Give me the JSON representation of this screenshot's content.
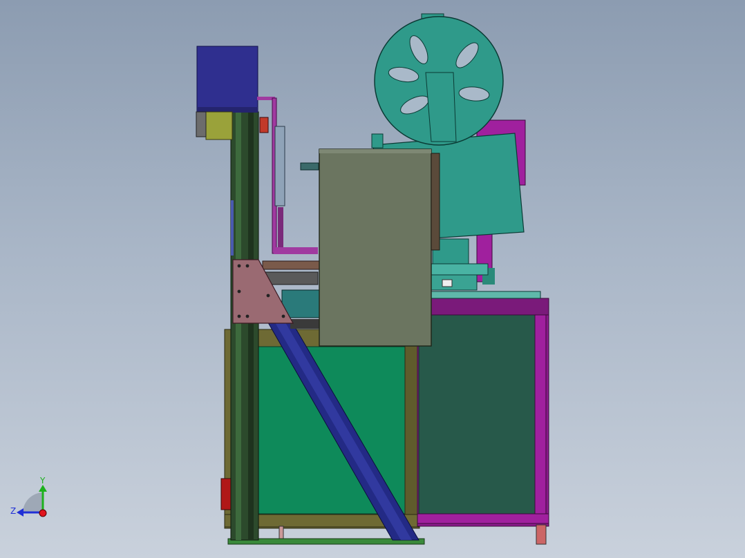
{
  "viewport": {
    "background_top": "#8c9cb1",
    "background_bottom": "#c9d1dc"
  },
  "triad": {
    "y_label": "Y",
    "z_label": "Z",
    "y_color": "#1db11d",
    "z_color": "#1f2fd6",
    "x_color": "#e0141e"
  },
  "model_colors": {
    "motor_box": "#2f2f8f",
    "column": "#2c4a2c",
    "gusset": "#9a6a72",
    "cover_panel": "#6b7560",
    "reel": "#2f9a8a",
    "frame_olive": "#6e6a34",
    "frame_magenta": "#8b1a8b",
    "panel_green": "#0e8a5a",
    "panel_dark_green": "#27594a",
    "diagonal_brace": "#232a85"
  }
}
